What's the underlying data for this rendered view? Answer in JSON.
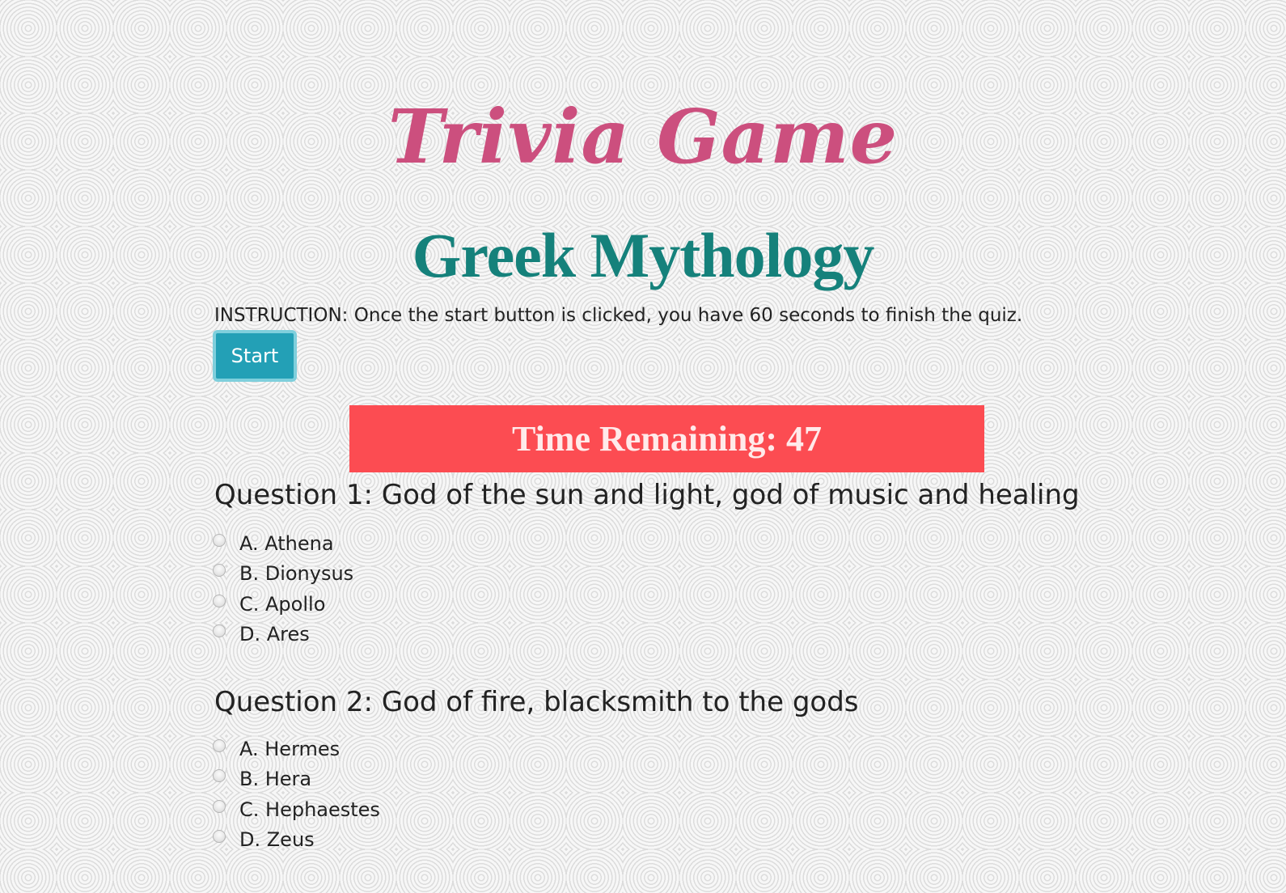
{
  "header": {
    "title": "Trivia Game",
    "subtitle": "Greek Mythology"
  },
  "instruction": "INSTRUCTION: Once the start button is clicked, you have 60 seconds to finish the quiz.",
  "start_button": {
    "label": "Start"
  },
  "timer": {
    "text": "Time Remaining: 47"
  },
  "questions": [
    {
      "text": "Question 1: God of the sun and light, god of music and healing",
      "options": [
        "A. Athena",
        "B. Dionysus",
        "C. Apollo",
        "D. Ares"
      ]
    },
    {
      "text": "Question 2: God of fire, blacksmith to the gods",
      "options": [
        "A. Hermes",
        "B. Hera",
        "C. Hephaestes",
        "D. Zeus"
      ]
    }
  ],
  "colors": {
    "title": "#cc4f7e",
    "subtitle": "#15817b",
    "start_button": "#23a0b6",
    "timer_background": "#fc4c52"
  }
}
